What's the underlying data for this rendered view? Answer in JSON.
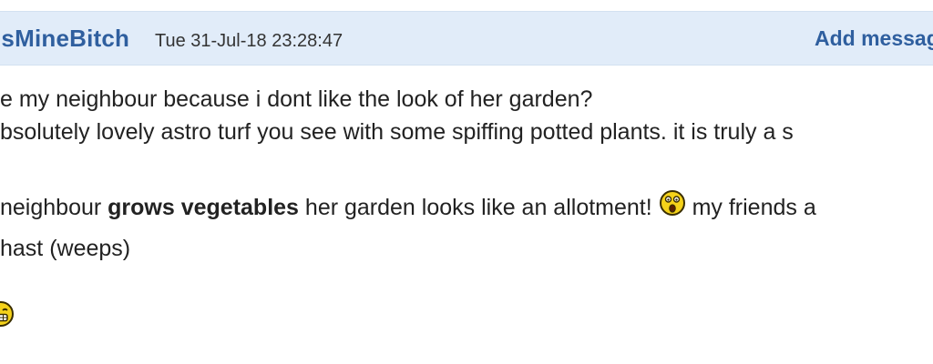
{
  "header": {
    "username": "IsMineBitch",
    "timestamp": "Tue 31-Jul-18 23:28:47",
    "add_message": "Add messag"
  },
  "body": {
    "line1": "e my neighbour because i dont like the look of her garden?",
    "line2": "bsolutely lovely astro turf you see with some spiffing potted plants. it is truly a s",
    "line3_pre": "neighbour ",
    "line3_bold": "grows vegetables",
    "line3_post": " her garden looks like an allotment! ",
    "line3_tail": " my friends a",
    "line4": "hast (weeps)"
  },
  "icons": {
    "emoji_shocked": "shocked-smiley-icon",
    "emoji_grin": "grin-smiley-icon"
  },
  "colors": {
    "header_bg": "#e1ecf9",
    "link": "#2f5f9f",
    "text": "#222222",
    "emoji_yellow": "#f5d21a"
  }
}
